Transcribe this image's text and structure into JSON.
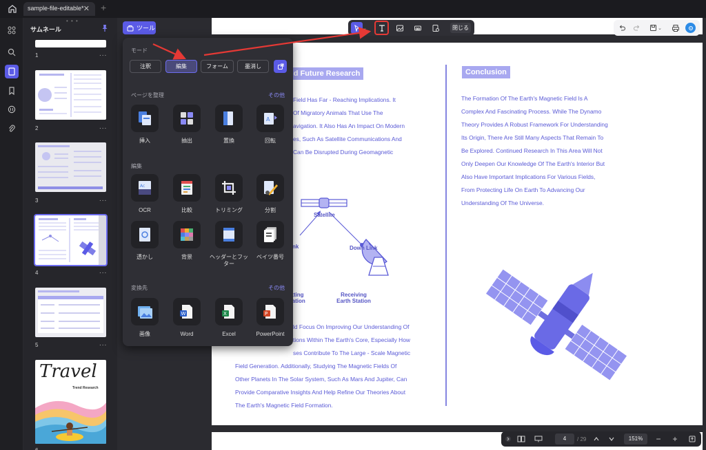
{
  "tabbar": {
    "tab_title": "sample-file-editable*",
    "close": "✕",
    "new_tab": "+"
  },
  "thumbnails": {
    "title": "サムネール",
    "more": "...",
    "pages": [
      "1",
      "2",
      "3",
      "4",
      "5",
      "6"
    ],
    "selected_page": "4",
    "page6_title": "Travel",
    "page6_subtitle": "Trend Research"
  },
  "tools_button": {
    "label": "ツール"
  },
  "center_toolbar": {
    "close_label": "閉じる"
  },
  "tools_panel": {
    "mode_label": "モード",
    "modes": [
      "注釈",
      "編集",
      "フォーム",
      "墨消し"
    ],
    "selected_mode": "編集",
    "organize_label": "ページを整理",
    "organize_more": "その他",
    "organize_tools": [
      "挿入",
      "抽出",
      "置換",
      "回転"
    ],
    "edit_label": "編集",
    "edit_tools": [
      "OCR",
      "比較",
      "トリミング",
      "分割",
      "透かし",
      "背景",
      "ヘッダーとフッター",
      "ベイツ番号"
    ],
    "convert_label": "変換先",
    "convert_more": "その他",
    "convert_tools": [
      "画像",
      "Word",
      "Excel",
      "PowerPoint"
    ]
  },
  "document": {
    "left_heading": "nd Future Research",
    "left_para1": [
      "Field Has Far - Reaching Implications. It",
      "Of Migratory Animals That Use The",
      "avigation. It Also Has An Impact On Modern",
      "es, Such As Satellite Communications And",
      "Can Be Disrupted During Geomagnetic"
    ],
    "diagram_labels": {
      "satellite": "Satellite",
      "down_link": "Down Link",
      "uplink": "nk",
      "transmitting_1": "itting",
      "transmitting_2": "tation",
      "receiving_1": "Receiving",
      "receiving_2": "Earth Station"
    },
    "left_para2": [
      "ld Focus On Improving Our Understanding Of",
      "tions Within The Earth's Core, Especially How",
      "ses Contribute To The Large - Scale Magnetic",
      "Field Generation. Additionally, Studying The Magnetic Fields Of",
      "Other Planets In The Solar System, Such As Mars And Jupiter, Can",
      "Provide Comparative Insights And Help Refine Our Theories About",
      "The Earth's Magnetic Field Formation."
    ],
    "right_heading": "Conclusion",
    "right_para": [
      "The Formation Of The Earth's Magnetic Field Is A",
      "Complex And Fascinating Process. While The Dynamo",
      "Theory Provides A Robust Framework For Understanding",
      "Its Origin, There Are Still Many Aspects That Remain To",
      "Be Explored. Continued Research In This Area Will Not",
      "Only Deepen Our Knowledge Of The Earth's Interior But",
      "Also Have Important Implications For Various Fields,",
      "From Protecting Life On Earth To Advancing Our",
      "Understanding Of The Universe."
    ]
  },
  "bottom_bar": {
    "page_current": "4",
    "page_total": "/ 29",
    "zoom": "151%",
    "minus": "−",
    "plus": "+"
  },
  "thumb_footer": {
    "prev": "‹",
    "dots": "...",
    "next": "›"
  },
  "colors": {
    "accent": "#5b5be6",
    "doc_text": "#5a5ad6",
    "highlight": "#e53935"
  }
}
